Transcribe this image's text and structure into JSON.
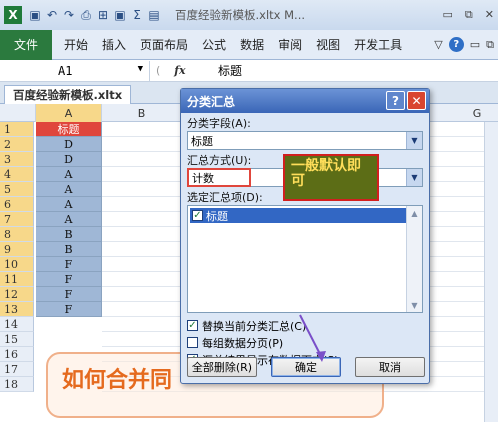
{
  "window": {
    "title": "百度经验新模板.xltx M...",
    "controls": [
      "▭",
      "▭",
      "✕"
    ]
  },
  "quickaccess": [
    "↶",
    "↷",
    "▾",
    "⎙",
    "⊞",
    "▣",
    "Σ",
    "▤",
    "▾"
  ],
  "ribbon": {
    "file_tab": "文件",
    "tabs": [
      "开始",
      "插入",
      "页面布局",
      "公式",
      "数据",
      "审阅",
      "视图",
      "开发工具"
    ],
    "help": "?"
  },
  "formula_bar": {
    "name_box": "A1",
    "fx": "fx",
    "value": "标题"
  },
  "sheet_tab": "百度经验新模板.xltx",
  "grid": {
    "columns": [
      "A",
      "B",
      "G"
    ],
    "rows": [
      {
        "num": "1",
        "a": "标题"
      },
      {
        "num": "2",
        "a": "D"
      },
      {
        "num": "3",
        "a": "D"
      },
      {
        "num": "4",
        "a": "A"
      },
      {
        "num": "5",
        "a": "A"
      },
      {
        "num": "6",
        "a": "A"
      },
      {
        "num": "7",
        "a": "A"
      },
      {
        "num": "8",
        "a": "B"
      },
      {
        "num": "9",
        "a": "B"
      },
      {
        "num": "10",
        "a": "F"
      },
      {
        "num": "11",
        "a": "F"
      },
      {
        "num": "12",
        "a": "F"
      },
      {
        "num": "13",
        "a": "F"
      },
      {
        "num": "14",
        "a": ""
      },
      {
        "num": "15",
        "a": ""
      },
      {
        "num": "16",
        "a": ""
      },
      {
        "num": "17",
        "a": ""
      },
      {
        "num": "18",
        "a": ""
      }
    ]
  },
  "banner_text": "如何合并同",
  "dialog": {
    "title": "分类汇总",
    "field_label": "分类字段(A):",
    "field_value": "标题",
    "method_label": "汇总方式(U):",
    "method_value": "计数",
    "items_label": "选定汇总项(D):",
    "items": [
      "标题"
    ],
    "options": [
      {
        "label": "替换当前分类汇总(C)",
        "checked": true
      },
      {
        "label": "每组数据分页(P)",
        "checked": false
      },
      {
        "label": "汇总结果显示在数据下方(S)",
        "checked": true
      }
    ],
    "buttons": {
      "remove_all": "全部删除(R)",
      "ok": "确定",
      "cancel": "取消"
    }
  },
  "callout_text": "一般默认即可",
  "colors": {
    "excel_green": "#1f7a3a",
    "dialog_blue": "#3a66b7",
    "header_red": "#e0463c",
    "callout_bg": "#5c6d16",
    "callout_text": "#ffde5a"
  }
}
